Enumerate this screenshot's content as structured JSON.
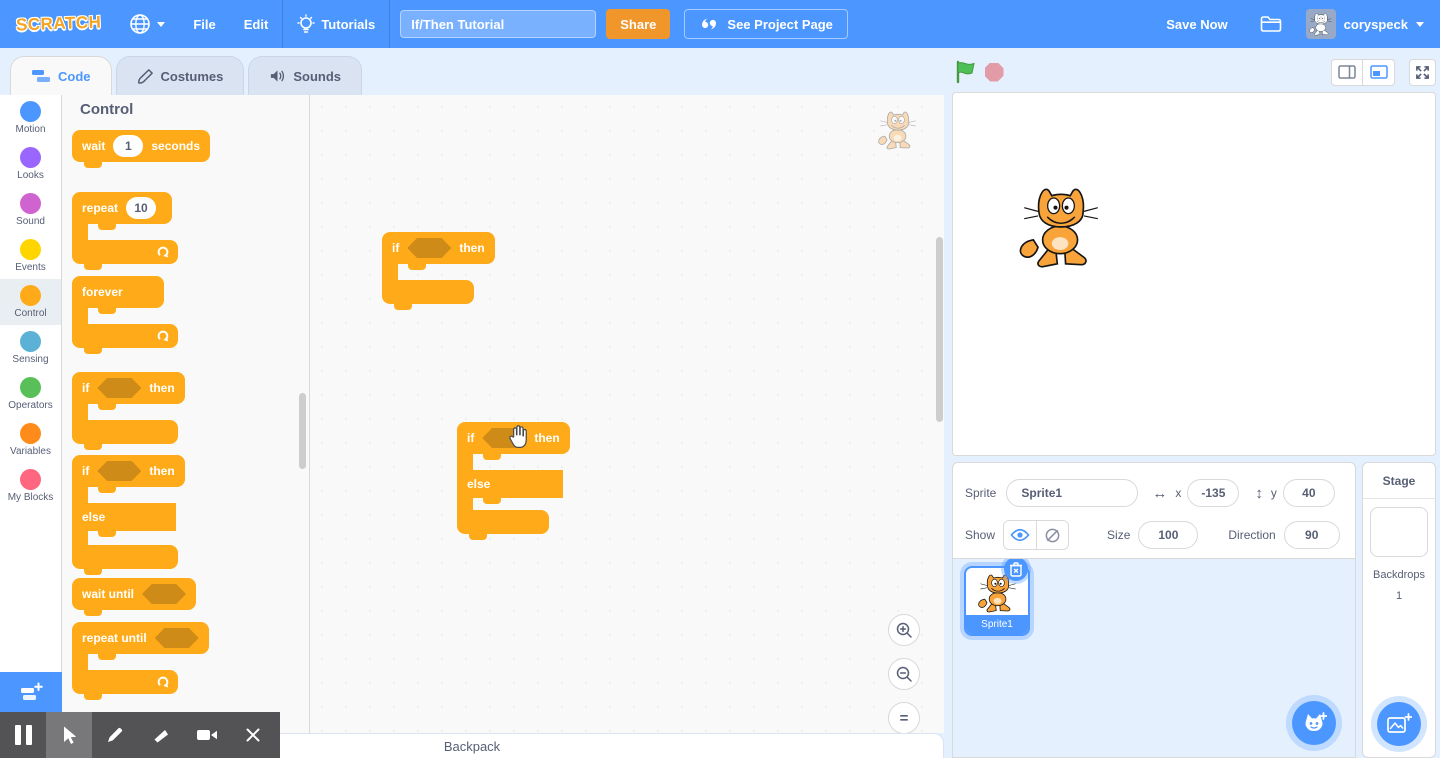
{
  "colors": {
    "menubar": "#4C97FF",
    "accent": "#4C97FF",
    "control_block": "#FFAB19",
    "control_block_shadow": "#CF8B17",
    "share_button": "#F0962B",
    "green_flag": "#4CBF56",
    "stop_sign": "#E39BA8",
    "page_bg": "#E5F0FF"
  },
  "menubar": {
    "logo": "SCRATCH",
    "file": "File",
    "edit": "Edit",
    "tutorials": "Tutorials",
    "project_title": "If/Then Tutorial",
    "share": "Share",
    "see_project_page": "See Project Page",
    "save_now": "Save Now",
    "username": "coryspeck"
  },
  "tabs": [
    {
      "label": "Code",
      "active": true
    },
    {
      "label": "Costumes",
      "active": false
    },
    {
      "label": "Sounds",
      "active": false
    }
  ],
  "sidebar": {
    "categories": [
      {
        "label": "Motion",
        "color": "#4C97FF",
        "selected": false
      },
      {
        "label": "Looks",
        "color": "#9966FF",
        "selected": false
      },
      {
        "label": "Sound",
        "color": "#CF63CF",
        "selected": false
      },
      {
        "label": "Events",
        "color": "#FFD500",
        "selected": false
      },
      {
        "label": "Control",
        "color": "#FFAB19",
        "selected": true
      },
      {
        "label": "Sensing",
        "color": "#5CB1D6",
        "selected": false
      },
      {
        "label": "Operators",
        "color": "#59C059",
        "selected": false
      },
      {
        "label": "Variables",
        "color": "#FF8C1A",
        "selected": false
      },
      {
        "label": "My Blocks",
        "color": "#FF6680",
        "selected": false
      }
    ]
  },
  "palette": {
    "header": "Control",
    "blocks": {
      "wait": {
        "t1": "wait",
        "value": "1",
        "t2": "seconds"
      },
      "repeat": {
        "t1": "repeat",
        "value": "10"
      },
      "forever": {
        "t1": "forever"
      },
      "if_then": {
        "t1": "if",
        "t2": "then"
      },
      "if_else": {
        "t1": "if",
        "t2": "then",
        "t3": "else"
      },
      "wait_until": {
        "t1": "wait until"
      },
      "repeat_until": {
        "t1": "repeat until"
      }
    }
  },
  "canvas": {
    "blocks": {
      "if_then": {
        "t1": "if",
        "t2": "then"
      },
      "if_else": {
        "t1": "if",
        "t2": "then",
        "t3": "else"
      }
    },
    "zoom_reset_label": "="
  },
  "sprite_panel": {
    "sprite_label": "Sprite",
    "sprite_name": "Sprite1",
    "x_label": "x",
    "x_value": "-135",
    "y_label": "y",
    "y_value": "40",
    "show_label": "Show",
    "size_label": "Size",
    "size_value": "100",
    "direction_label": "Direction",
    "direction_value": "90"
  },
  "sprite_list": {
    "sprite1_name": "Sprite1"
  },
  "stage_panel": {
    "title": "Stage",
    "backdrops_label": "Backdrops",
    "backdrops_count": "1"
  },
  "backpack": {
    "label": "Backpack"
  }
}
